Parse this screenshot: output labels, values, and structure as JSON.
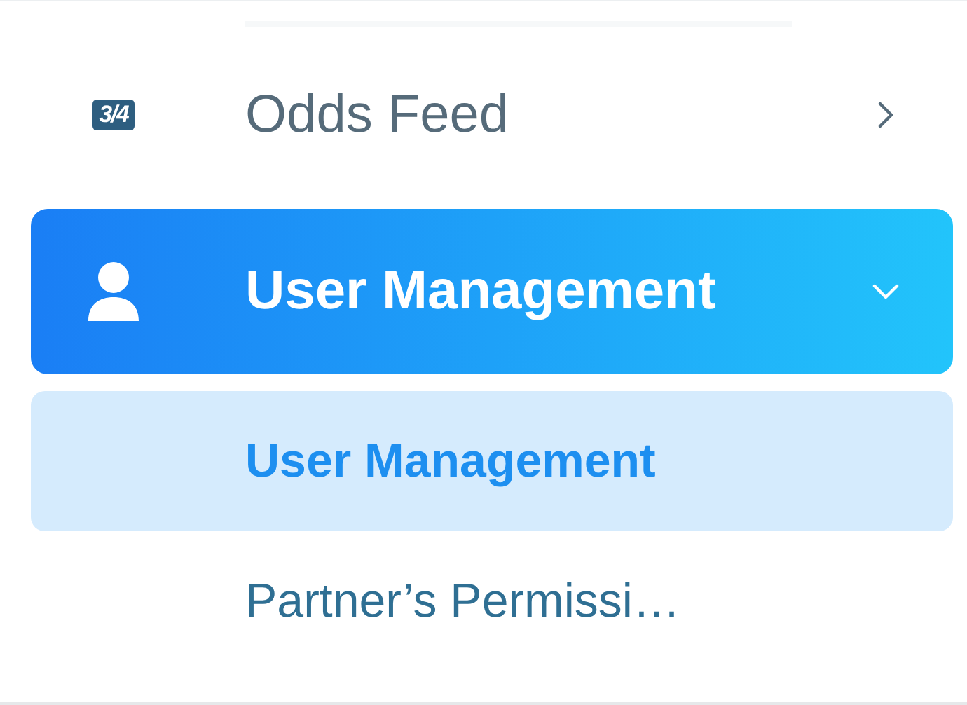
{
  "menu": [
    {
      "label": "Odds Feed",
      "icon_text": "3/4",
      "selected": false,
      "expanded": false
    },
    {
      "label": "User Management",
      "selected": true,
      "expanded": true,
      "children": [
        {
          "label": "User Management",
          "selected": true
        },
        {
          "label": "Partner’s Permissi…",
          "selected": false
        }
      ]
    }
  ]
}
